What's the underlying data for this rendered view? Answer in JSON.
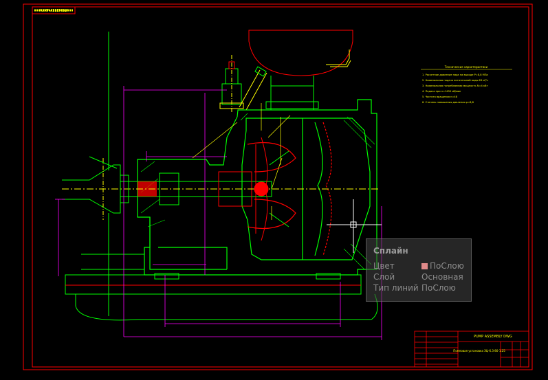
{
  "drawing": {
    "title_block_top": "PUMP ASSEMBLY DWG",
    "title_block_name": "Помповая установка ЭЦ-6.3-80-1.25",
    "corner_stamp": "PUMP ASSEMBLY"
  },
  "notes": {
    "heading": "Технические характеристики",
    "lines": [
      "1. Расчетное давление пара на выходе P=8,8 МПа",
      "2. Номинальная подача питательной воды 63 м³/ч",
      "3. Номинальная потребляемая мощность N=4 кВт",
      "4. Подача при n=1450 об/мин",
      "5. Частота вращения n=48",
      "6. Степень повышения давления p=8,8"
    ]
  },
  "properties_tooltip": {
    "title": "Сплайн",
    "rows": [
      {
        "key": "Цвет",
        "value": "ПоСлою",
        "swatch": "#e08a8a"
      },
      {
        "key": "Слой",
        "value": "Основная"
      },
      {
        "key": "Тип линий",
        "value": "ПоСлою"
      }
    ]
  },
  "colors": {
    "background": "#000000",
    "frame": "#ff0000",
    "main": "#00ff00",
    "dimension": "#ff00ff",
    "axis": "#ffff00",
    "cursor": "#ffffff",
    "secondary": "#ff0000"
  }
}
